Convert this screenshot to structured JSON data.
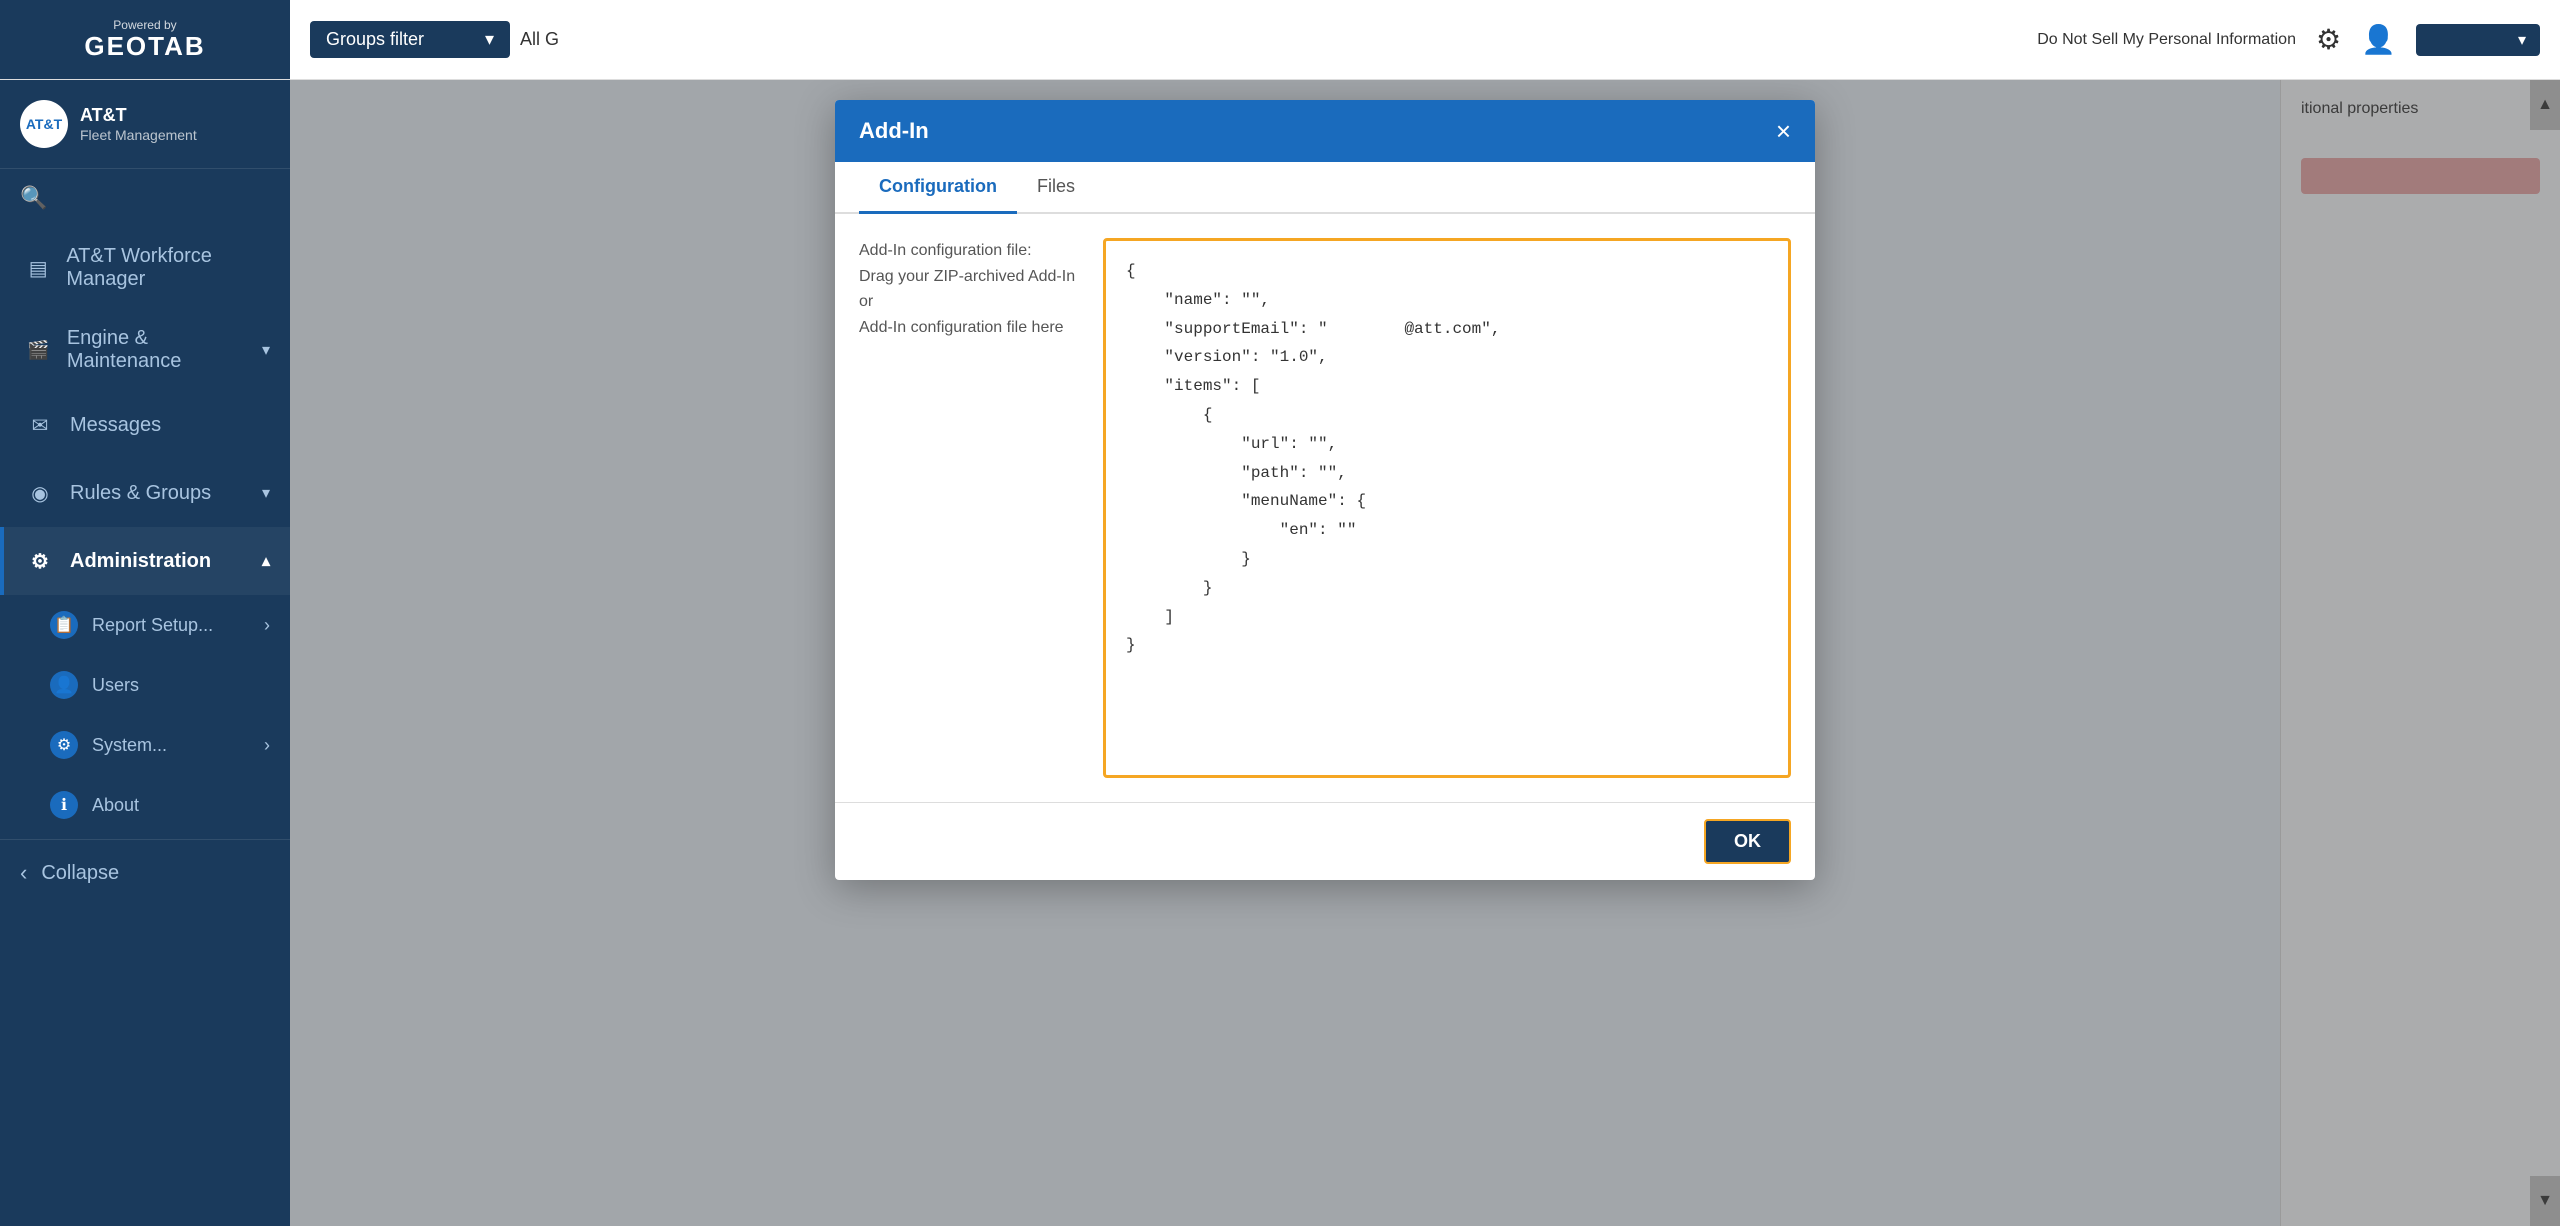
{
  "topbar": {
    "powered_by": "Powered by",
    "brand": "GEOTAB",
    "groups_filter_label": "Groups filter",
    "groups_filter_chevron": "▼",
    "do_not_sell": "Do Not Sell My Personal Information",
    "all_label": "All G"
  },
  "sidebar": {
    "brand_name": "AT&T",
    "brand_sub": "Fleet Management",
    "items": [
      {
        "id": "att-workforce",
        "label": "AT&T Workforce Manager",
        "icon": "▤",
        "has_chevron": false
      },
      {
        "id": "engine-maintenance",
        "label": "Engine & Maintenance",
        "icon": "🎬",
        "has_chevron": true
      },
      {
        "id": "messages",
        "label": "Messages",
        "icon": "✉",
        "has_chevron": false
      },
      {
        "id": "rules-groups",
        "label": "Rules & Groups",
        "icon": "◉",
        "has_chevron": true
      },
      {
        "id": "administration",
        "label": "Administration",
        "icon": "⚙",
        "has_chevron": true,
        "active": true
      }
    ],
    "sub_items": [
      {
        "id": "report-setup",
        "label": "Report Setup...",
        "icon": "📋"
      },
      {
        "id": "users",
        "label": "Users",
        "icon": "👤"
      },
      {
        "id": "system",
        "label": "System...",
        "icon": "⚙"
      },
      {
        "id": "about",
        "label": "About",
        "icon": "ℹ"
      }
    ],
    "collapse_label": "Collapse",
    "search_label": "search"
  },
  "modal": {
    "title": "Add-In",
    "close_label": "×",
    "tabs": [
      {
        "id": "configuration",
        "label": "Configuration",
        "active": true
      },
      {
        "id": "files",
        "label": "Files",
        "active": false
      }
    ],
    "left_label_line1": "Add-In configuration file:",
    "left_label_line2": "Drag your ZIP-archived Add-In or",
    "left_label_line3": "Add-In configuration file here",
    "json_content": [
      "{",
      "    \"name\": \"\",",
      "    \"supportEmail\": \"        @att.com\",",
      "    \"version\": \"1.0\",",
      "    \"items\": [",
      "        {",
      "            \"url\": \"\",",
      "            \"path\": \"\",",
      "            \"menuName\": {",
      "                \"en\": \"\"",
      "            }",
      "        }",
      "    ]",
      "}"
    ],
    "footer": {
      "ok_label": "OK"
    }
  },
  "right_panel": {
    "label": "itional properties",
    "button_label": ""
  },
  "icons": {
    "gear": "⚙",
    "user": "👤",
    "chevron_down": "▾",
    "chevron_right": "›",
    "chevron_up": "▴",
    "collapse_arrow": "‹",
    "scroll_up": "▲",
    "scroll_down": "▼"
  }
}
